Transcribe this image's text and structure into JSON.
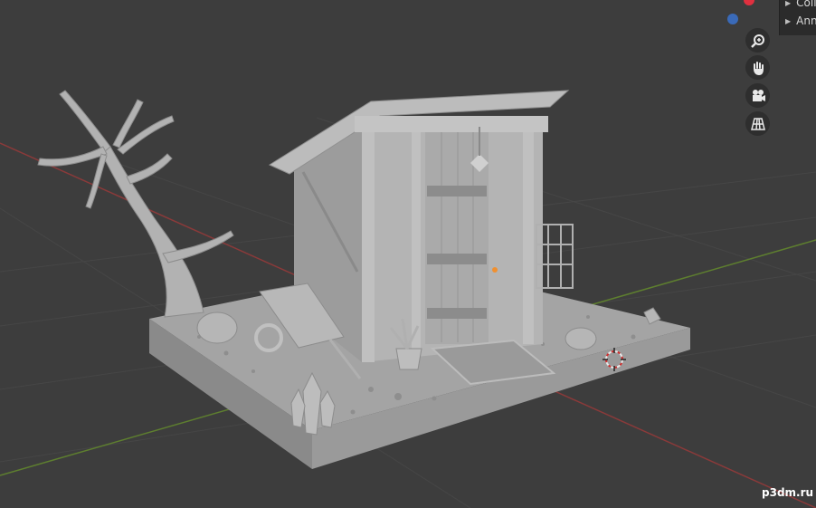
{
  "outliner": {
    "items": [
      {
        "label": "Coll"
      },
      {
        "label": "Ann"
      }
    ]
  },
  "navigation": {
    "axis_colors": {
      "x": "#e0303f",
      "z": "#3a6ab8"
    },
    "buttons": [
      {
        "icon": "zoom-icon"
      },
      {
        "icon": "hand-pan-icon"
      },
      {
        "icon": "camera-icon"
      },
      {
        "icon": "grid-perspective-icon"
      }
    ]
  },
  "viewport": {
    "background": "#3d3d3d",
    "grid_color": "#474747",
    "x_axis_color": "#8a3a3a",
    "y_axis_color": "#5e7f2f",
    "model_color": "#a8a8a8"
  },
  "watermark": {
    "text": "p3dm.ru"
  }
}
